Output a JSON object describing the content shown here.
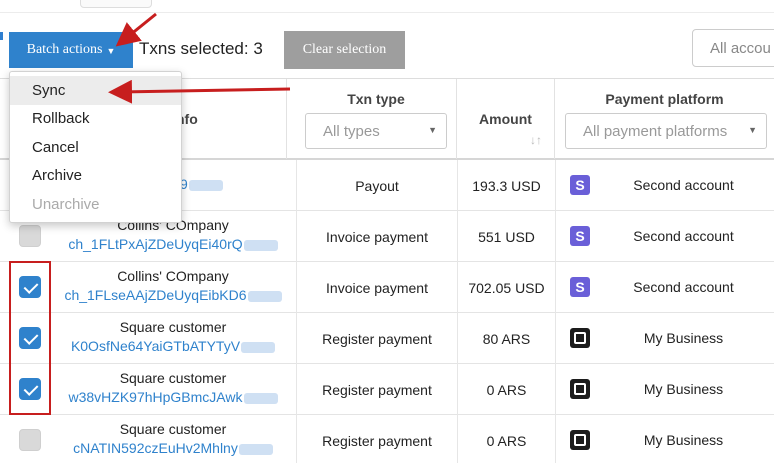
{
  "toolbar": {
    "batch_label": "Batch actions",
    "selected_text": "Txns selected: 3",
    "clear_label": "Clear selection",
    "account_filter_placeholder": "All accou"
  },
  "batch_menu": {
    "items": [
      {
        "label": "Sync",
        "active": true,
        "disabled": false
      },
      {
        "label": "Rollback",
        "active": false,
        "disabled": false
      },
      {
        "label": "Cancel",
        "active": false,
        "disabled": false
      },
      {
        "label": "Archive",
        "active": false,
        "disabled": false
      },
      {
        "label": "Unarchive",
        "active": false,
        "disabled": true
      }
    ]
  },
  "table": {
    "headers": {
      "info": "nfo",
      "txn_type": "Txn type",
      "txn_type_filter": "All types",
      "amount": "Amount",
      "platform": "Payment platform",
      "platform_filter": "All payment platforms"
    },
    "rows": [
      {
        "checked": false,
        "customer": "",
        "charge_id": "eUyqEilF9",
        "txn_type": "Payout",
        "amount": "193.3 USD",
        "platform_icon": "stripe-icon",
        "account": "Second account",
        "shaded": false
      },
      {
        "checked": false,
        "customer": "Collins' COmpany",
        "charge_id": "ch_1FLtPxAjZDeUyqEi40rQ",
        "txn_type": "Invoice payment",
        "amount": "551 USD",
        "platform_icon": "stripe-icon",
        "account": "Second account",
        "shaded": false
      },
      {
        "checked": true,
        "customer": "Collins' COmpany",
        "charge_id": "ch_1FLseAAjZDeUyqEibKD6",
        "txn_type": "Invoice payment",
        "amount": "702.05 USD",
        "platform_icon": "stripe-icon",
        "account": "Second account",
        "shaded": false
      },
      {
        "checked": true,
        "customer": "Square customer",
        "charge_id": "K0OsfNe64YaiGTbATYTyV",
        "txn_type": "Register payment",
        "amount": "80 ARS",
        "platform_icon": "square-icon",
        "account": "My Business",
        "shaded": false
      },
      {
        "checked": true,
        "customer": "Square customer",
        "charge_id": "w38vHZK97hHpGBmcJAwk",
        "txn_type": "Register payment",
        "amount": "0 ARS",
        "platform_icon": "square-icon",
        "account": "My Business",
        "shaded": false
      },
      {
        "checked": false,
        "customer": "Square customer",
        "charge_id": "cNATIN592czEuHv2Mhlny",
        "txn_type": "Register payment",
        "amount": "0 ARS",
        "platform_icon": "square-icon",
        "account": "My Business",
        "shaded": false
      }
    ]
  },
  "colors": {
    "primary": "#2f82cc",
    "annotation": "#c71e1e",
    "stripe": "#6a5fd8",
    "square": "#1c1c1c"
  }
}
